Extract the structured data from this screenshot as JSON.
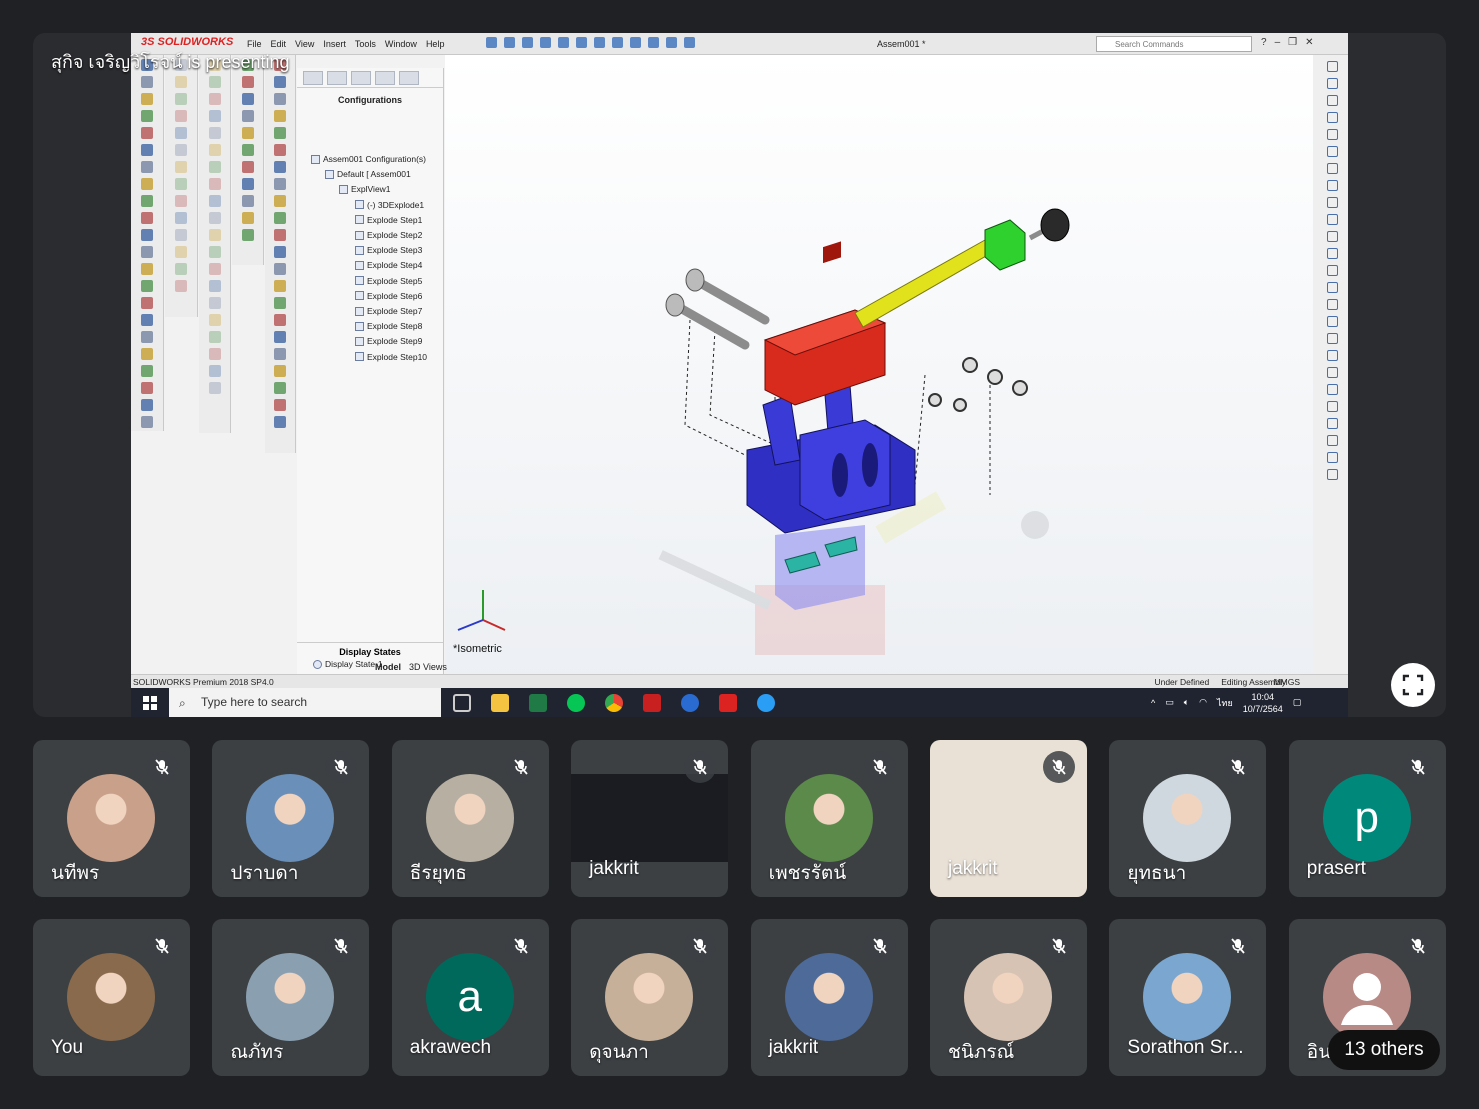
{
  "presenter": {
    "label": "สุกิจ เจริญวิโรจน์ is presenting"
  },
  "solidworks": {
    "logo": "3S SOLIDWORKS",
    "menu": [
      "File",
      "Edit",
      "View",
      "Insert",
      "Tools",
      "Window",
      "Help"
    ],
    "doc_title": "Assem001 *",
    "search_placeholder": "Search Commands",
    "tree": {
      "title": "Configurations",
      "rows": [
        "Assem001 Configuration(s)",
        "Default [ Assem001",
        "ExplView1",
        "(-) 3DExplode1",
        "Explode Step1",
        "Explode Step2",
        "Explode Step3",
        "Explode Step4",
        "Explode Step5",
        "Explode Step6",
        "Explode Step7",
        "Explode Step8",
        "Explode Step9",
        "Explode Step10"
      ],
      "display_states_title": "Display States",
      "display_state": "Display State-1"
    },
    "view_label": "*Isometric",
    "bottom_tabs": [
      "Model",
      "3D Views"
    ],
    "status": {
      "product": "SOLIDWORKS Premium 2018 SP4.0",
      "definition": "Under Defined",
      "mode": "Editing Assembly",
      "units": "MMGS"
    },
    "model_colors": {
      "housing": "#3a3ad6",
      "block": "#d92a1e",
      "shaft": "#e2e21c",
      "cap": "#2fd12f",
      "pins": "#8c8c8c"
    }
  },
  "taskbar": {
    "search_placeholder": "Type here to search",
    "language": "ไทย",
    "time": "10:04",
    "date": "10/7/2564"
  },
  "participants": [
    {
      "name": "นทีพร",
      "kind": "photo",
      "color": "#c9a08a"
    },
    {
      "name": "ปราบดา",
      "kind": "photo",
      "color": "#6a8fb8"
    },
    {
      "name": "ธีรยุทธ",
      "kind": "photo",
      "color": "#b7b0a2"
    },
    {
      "name": "jakkrit",
      "kind": "screen",
      "color": "#1a1c22"
    },
    {
      "name": "เพชรรัตน์",
      "kind": "photo",
      "color": "#5b8a4a"
    },
    {
      "name": "jakkrit",
      "kind": "cert",
      "color": "#e9e1d6"
    },
    {
      "name": "ยุทธนา",
      "kind": "photo",
      "color": "#cfd8de"
    },
    {
      "name": "prasert",
      "kind": "letter",
      "letter": "p",
      "color": "#00897b"
    },
    {
      "name": "You",
      "kind": "photo",
      "color": "#8a6a4c"
    },
    {
      "name": "ณภัทร",
      "kind": "photo",
      "color": "#8aa0b0"
    },
    {
      "name": "akrawech",
      "kind": "letter",
      "letter": "a",
      "color": "#00695c"
    },
    {
      "name": "ดุจนภา",
      "kind": "photo",
      "color": "#c6b09a"
    },
    {
      "name": "jakkrit",
      "kind": "photo",
      "color": "#4d6a99"
    },
    {
      "name": "ชนิภรณ์",
      "kind": "photo",
      "color": "#d6c3b4"
    },
    {
      "name": "Sorathon Sr...",
      "kind": "photo",
      "color": "#7aa6cf"
    },
    {
      "name": "อิน",
      "kind": "generic",
      "color": "#b88a86"
    }
  ],
  "others": {
    "label": "13 others"
  }
}
